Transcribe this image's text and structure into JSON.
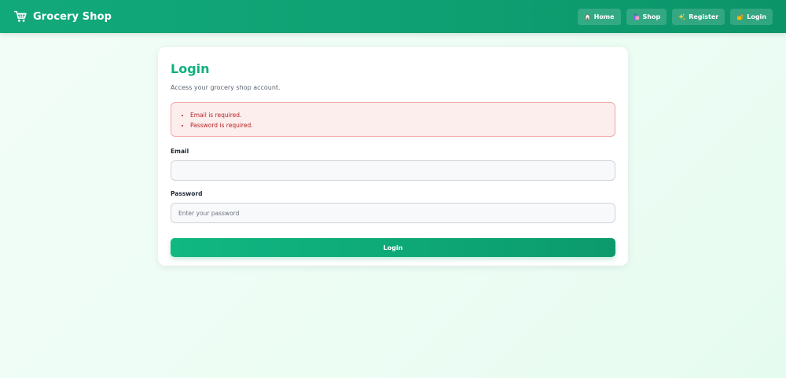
{
  "header": {
    "brand": "Grocery Shop",
    "nav": [
      {
        "label": "Home",
        "icon": "house-icon"
      },
      {
        "label": "Shop",
        "icon": "shopping-bags-icon"
      },
      {
        "label": "Register",
        "icon": "sparkles-icon"
      },
      {
        "label": "Login",
        "icon": "lock-key-icon"
      }
    ]
  },
  "login": {
    "title": "Login",
    "subtitle": "Access your grocery shop account.",
    "errors": [
      "Email is required.",
      "Password is required."
    ],
    "email_label": "Email",
    "email_value": "",
    "email_placeholder": "",
    "password_label": "Password",
    "password_placeholder": "Enter your password",
    "submit_label": "Login"
  },
  "colors": {
    "accent": "#10b07f",
    "header": "#0ea072",
    "error_text": "#b42323",
    "error_bg": "#fdeeee"
  }
}
